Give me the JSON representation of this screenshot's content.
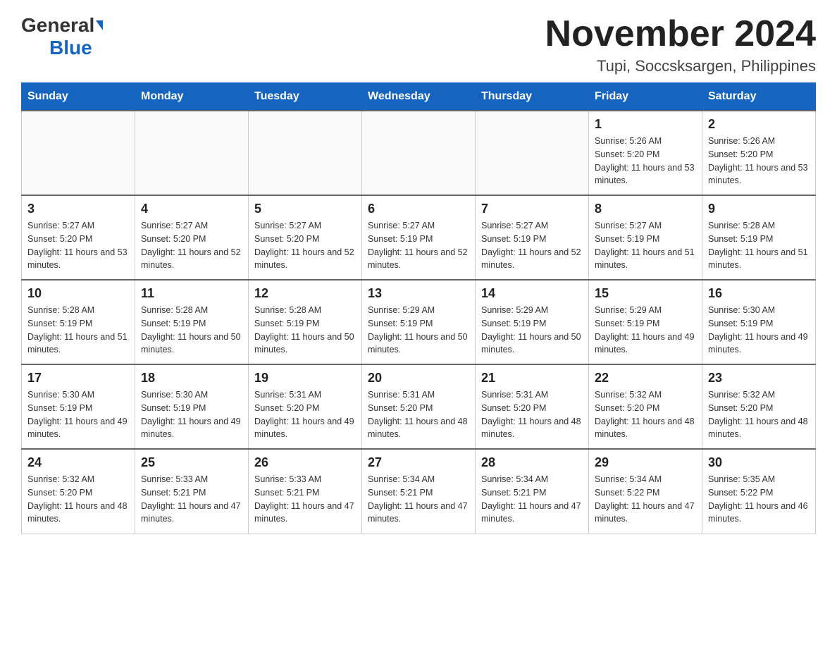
{
  "header": {
    "logo_general": "General",
    "logo_blue": "Blue",
    "month_title": "November 2024",
    "location": "Tupi, Soccsksargen, Philippines"
  },
  "days_of_week": [
    "Sunday",
    "Monday",
    "Tuesday",
    "Wednesday",
    "Thursday",
    "Friday",
    "Saturday"
  ],
  "weeks": [
    [
      {
        "day": "",
        "info": ""
      },
      {
        "day": "",
        "info": ""
      },
      {
        "day": "",
        "info": ""
      },
      {
        "day": "",
        "info": ""
      },
      {
        "day": "",
        "info": ""
      },
      {
        "day": "1",
        "info": "Sunrise: 5:26 AM\nSunset: 5:20 PM\nDaylight: 11 hours and 53 minutes."
      },
      {
        "day": "2",
        "info": "Sunrise: 5:26 AM\nSunset: 5:20 PM\nDaylight: 11 hours and 53 minutes."
      }
    ],
    [
      {
        "day": "3",
        "info": "Sunrise: 5:27 AM\nSunset: 5:20 PM\nDaylight: 11 hours and 53 minutes."
      },
      {
        "day": "4",
        "info": "Sunrise: 5:27 AM\nSunset: 5:20 PM\nDaylight: 11 hours and 52 minutes."
      },
      {
        "day": "5",
        "info": "Sunrise: 5:27 AM\nSunset: 5:20 PM\nDaylight: 11 hours and 52 minutes."
      },
      {
        "day": "6",
        "info": "Sunrise: 5:27 AM\nSunset: 5:19 PM\nDaylight: 11 hours and 52 minutes."
      },
      {
        "day": "7",
        "info": "Sunrise: 5:27 AM\nSunset: 5:19 PM\nDaylight: 11 hours and 52 minutes."
      },
      {
        "day": "8",
        "info": "Sunrise: 5:27 AM\nSunset: 5:19 PM\nDaylight: 11 hours and 51 minutes."
      },
      {
        "day": "9",
        "info": "Sunrise: 5:28 AM\nSunset: 5:19 PM\nDaylight: 11 hours and 51 minutes."
      }
    ],
    [
      {
        "day": "10",
        "info": "Sunrise: 5:28 AM\nSunset: 5:19 PM\nDaylight: 11 hours and 51 minutes."
      },
      {
        "day": "11",
        "info": "Sunrise: 5:28 AM\nSunset: 5:19 PM\nDaylight: 11 hours and 50 minutes."
      },
      {
        "day": "12",
        "info": "Sunrise: 5:28 AM\nSunset: 5:19 PM\nDaylight: 11 hours and 50 minutes."
      },
      {
        "day": "13",
        "info": "Sunrise: 5:29 AM\nSunset: 5:19 PM\nDaylight: 11 hours and 50 minutes."
      },
      {
        "day": "14",
        "info": "Sunrise: 5:29 AM\nSunset: 5:19 PM\nDaylight: 11 hours and 50 minutes."
      },
      {
        "day": "15",
        "info": "Sunrise: 5:29 AM\nSunset: 5:19 PM\nDaylight: 11 hours and 49 minutes."
      },
      {
        "day": "16",
        "info": "Sunrise: 5:30 AM\nSunset: 5:19 PM\nDaylight: 11 hours and 49 minutes."
      }
    ],
    [
      {
        "day": "17",
        "info": "Sunrise: 5:30 AM\nSunset: 5:19 PM\nDaylight: 11 hours and 49 minutes."
      },
      {
        "day": "18",
        "info": "Sunrise: 5:30 AM\nSunset: 5:19 PM\nDaylight: 11 hours and 49 minutes."
      },
      {
        "day": "19",
        "info": "Sunrise: 5:31 AM\nSunset: 5:20 PM\nDaylight: 11 hours and 49 minutes."
      },
      {
        "day": "20",
        "info": "Sunrise: 5:31 AM\nSunset: 5:20 PM\nDaylight: 11 hours and 48 minutes."
      },
      {
        "day": "21",
        "info": "Sunrise: 5:31 AM\nSunset: 5:20 PM\nDaylight: 11 hours and 48 minutes."
      },
      {
        "day": "22",
        "info": "Sunrise: 5:32 AM\nSunset: 5:20 PM\nDaylight: 11 hours and 48 minutes."
      },
      {
        "day": "23",
        "info": "Sunrise: 5:32 AM\nSunset: 5:20 PM\nDaylight: 11 hours and 48 minutes."
      }
    ],
    [
      {
        "day": "24",
        "info": "Sunrise: 5:32 AM\nSunset: 5:20 PM\nDaylight: 11 hours and 48 minutes."
      },
      {
        "day": "25",
        "info": "Sunrise: 5:33 AM\nSunset: 5:21 PM\nDaylight: 11 hours and 47 minutes."
      },
      {
        "day": "26",
        "info": "Sunrise: 5:33 AM\nSunset: 5:21 PM\nDaylight: 11 hours and 47 minutes."
      },
      {
        "day": "27",
        "info": "Sunrise: 5:34 AM\nSunset: 5:21 PM\nDaylight: 11 hours and 47 minutes."
      },
      {
        "day": "28",
        "info": "Sunrise: 5:34 AM\nSunset: 5:21 PM\nDaylight: 11 hours and 47 minutes."
      },
      {
        "day": "29",
        "info": "Sunrise: 5:34 AM\nSunset: 5:22 PM\nDaylight: 11 hours and 47 minutes."
      },
      {
        "day": "30",
        "info": "Sunrise: 5:35 AM\nSunset: 5:22 PM\nDaylight: 11 hours and 46 minutes."
      }
    ]
  ]
}
